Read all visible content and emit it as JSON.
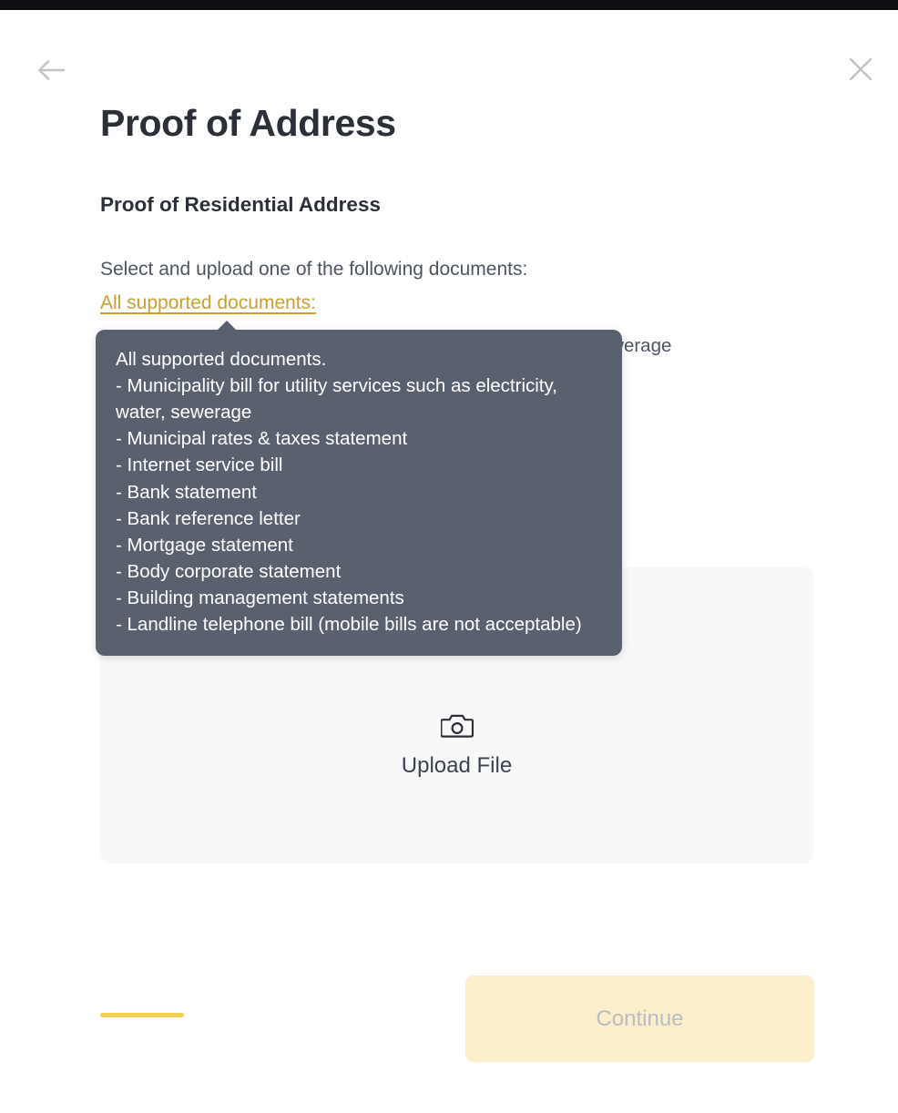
{
  "theme": {
    "accent_link": "#c9a12c",
    "accent_progress": "#f5d053",
    "button_disabled_bg": "#fbefcb",
    "button_disabled_text": "#b9bcc2",
    "tooltip_bg": "#5a616e",
    "upload_box_bg": "#f8f8f9",
    "heading_color": "#2b2f38",
    "body_color": "#4e5562"
  },
  "nav": {
    "back_icon": "arrow-left-icon",
    "close_icon": "close-icon"
  },
  "header": {
    "title": "Proof of Address",
    "section_title": "Proof of Residential Address"
  },
  "body": {
    "instruction": "Select and upload one of the following documents:",
    "supported_link_label": "All supported documents:",
    "document_items": [
      "Municipality bill for utility services such as electricity, water, sewerage",
      "Municipal rates & taxes statement",
      "Internet service bill",
      "Bank statement",
      "Bank reference letter",
      "Mortgage statement",
      "Body corporate statement",
      "Building management statements",
      "Landline telephone bill (mobile bills are not acceptable)"
    ]
  },
  "tooltip": {
    "visible": true,
    "heading": "All supported documents.",
    "items": [
      "- Municipality bill for utility services such as electricity, water, sewerage",
      "- Municipal rates & taxes statement",
      "- Internet service bill",
      "- Bank statement",
      "- Bank reference letter",
      "- Mortgage statement",
      "- Body corporate statement",
      "- Building management statements",
      "- Landline telephone bill (mobile bills are not acceptable)"
    ],
    "full_text": "All supported documents.\n- Municipality bill for utility services such as electricity, water, sewerage\n- Municipal rates & taxes statement\n- Internet service bill\n- Bank statement\n- Bank reference letter\n- Mortgage statement\n- Body corporate statement\n- Building management statements\n- Landline telephone bill (mobile bills are not acceptable)"
  },
  "upload": {
    "icon": "camera-icon",
    "label": "Upload File"
  },
  "footer": {
    "continue_label": "Continue",
    "continue_enabled": false,
    "progress_percent": 100
  }
}
